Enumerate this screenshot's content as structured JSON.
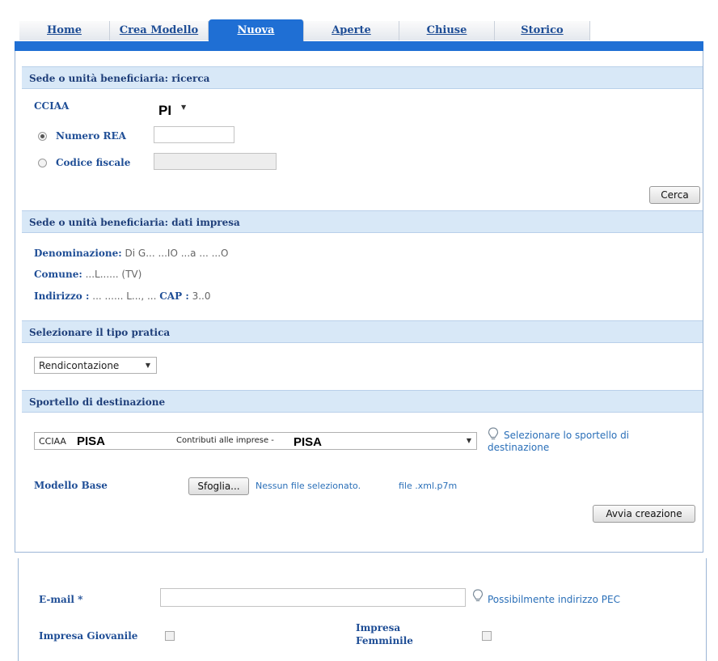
{
  "tabs": [
    "Home",
    "Crea Modello",
    "Nuova",
    "Aperte",
    "Chiuse",
    "Storico"
  ],
  "ricerca": {
    "title": "Sede o unità beneficiaria: ricerca",
    "cciaa_label": "CCIAA",
    "cciaa_value": "PI",
    "rea_label": "Numero REA",
    "rea_value": "",
    "cf_label": "Codice fiscale",
    "cf_value": "",
    "search_button": "Cerca"
  },
  "impresa": {
    "title": "Sede o unità beneficiaria: dati impresa",
    "denominazione_label": "Denominazione:",
    "denominazione_value": "Di G... ...IO ...a ... ...O",
    "comune_label": "Comune:",
    "comune_value": "...L...... (TV)",
    "indirizzo_label": "Indirizzo :",
    "indirizzo_value": "... ...... L..., ...",
    "cap_label": "CAP :",
    "cap_value": "3..0"
  },
  "tipo_pratica": {
    "title": "Selezionare il tipo pratica",
    "selected": "Rendicontazione"
  },
  "sportello": {
    "title": "Sportello di destinazione",
    "prefix": "CCIAA",
    "cciaa": "PISA",
    "service": "Contributi alle imprese -",
    "service_cciaa": "PISA",
    "hint": "Selezionare lo sportello di destinazione",
    "modello_label": "Modello Base",
    "browse_button": "Sfoglia...",
    "no_file": "Nessun file selezionato.",
    "file_ext": "file .xml.p7m",
    "create_button": "Avvia creazione"
  },
  "contatti": {
    "email_label": "E-mail *",
    "email_value": "",
    "email_hint": "Possibilmente indirizzo PEC",
    "giovanile_label": "Impresa Giovanile",
    "femminile_label_1": "Impresa",
    "femminile_label_2": "Femminile"
  }
}
